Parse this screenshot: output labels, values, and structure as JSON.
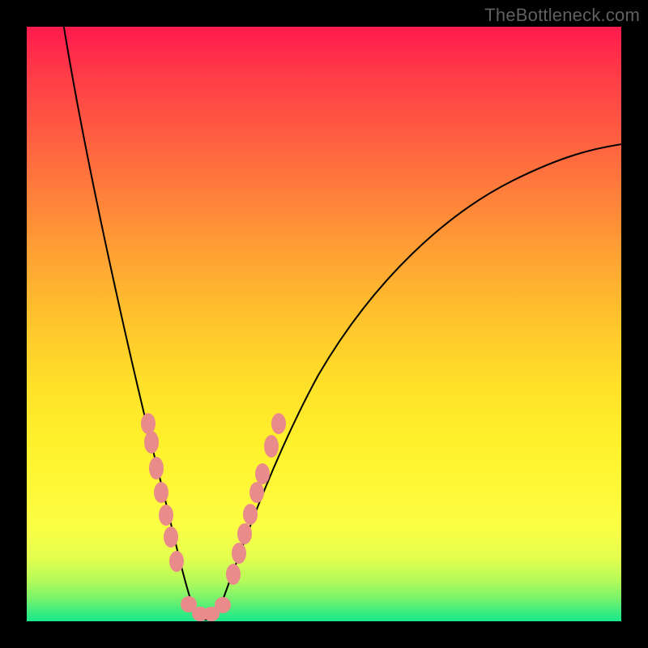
{
  "watermark": "TheBottleneck.com",
  "chart_data": {
    "type": "line",
    "title": "",
    "xlabel": "",
    "ylabel": "",
    "xlim": [
      0,
      100
    ],
    "ylim": [
      0,
      100
    ],
    "grid": false,
    "legend": false,
    "series": [
      {
        "name": "bottleneck-curve",
        "curve_kind": "v-shape",
        "left_branch_start": {
          "x": 6,
          "y": 100
        },
        "apex": {
          "x": 28,
          "y": 0
        },
        "right_branch_end": {
          "x": 98,
          "y": 80
        },
        "notes": "Sharp asymmetric V; left branch near-vertical, right branch concave rising"
      }
    ],
    "highlight_clusters": [
      {
        "name": "left-branch-beads",
        "approx_points": [
          {
            "x": 20,
            "y": 36
          },
          {
            "x": 20.5,
            "y": 33
          },
          {
            "x": 21.3,
            "y": 28
          },
          {
            "x": 22.0,
            "y": 24
          },
          {
            "x": 22.8,
            "y": 20
          },
          {
            "x": 23.5,
            "y": 16
          },
          {
            "x": 24.3,
            "y": 12
          }
        ]
      },
      {
        "name": "apex-beads",
        "approx_points": [
          {
            "x": 26.5,
            "y": 2
          },
          {
            "x": 28.0,
            "y": 1
          },
          {
            "x": 29.5,
            "y": 1.5
          },
          {
            "x": 31.0,
            "y": 2.5
          }
        ]
      },
      {
        "name": "right-branch-beads",
        "approx_points": [
          {
            "x": 33.0,
            "y": 9
          },
          {
            "x": 34.0,
            "y": 13
          },
          {
            "x": 34.8,
            "y": 16
          },
          {
            "x": 35.5,
            "y": 19
          },
          {
            "x": 36.5,
            "y": 23
          },
          {
            "x": 37.2,
            "y": 26
          },
          {
            "x": 38.5,
            "y": 31
          },
          {
            "x": 39.5,
            "y": 35
          }
        ]
      }
    ],
    "background_gradient": {
      "orientation": "vertical",
      "stops": [
        {
          "pos": 0.0,
          "color": "#ff1a4d"
        },
        {
          "pos": 0.5,
          "color": "#ffd22b"
        },
        {
          "pos": 0.8,
          "color": "#fff838"
        },
        {
          "pos": 1.0,
          "color": "#18e98d"
        }
      ]
    }
  }
}
